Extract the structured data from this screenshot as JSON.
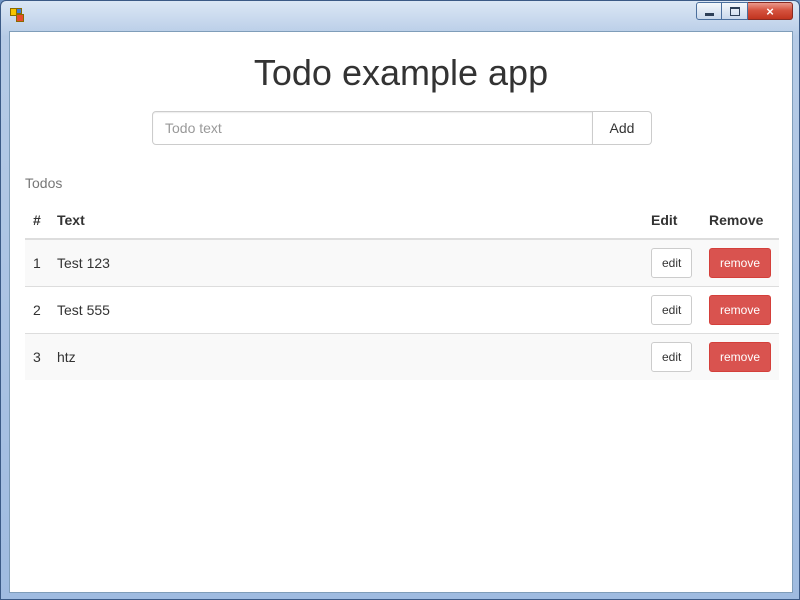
{
  "window": {
    "icon": "app-window-icon",
    "controls": {
      "minimize": "minimize-icon",
      "maximize": "maximize-icon",
      "close": "×"
    }
  },
  "app": {
    "title": "Todo example app",
    "input": {
      "value": "",
      "placeholder": "Todo text"
    },
    "add_label": "Add",
    "section_label": "Todos"
  },
  "table": {
    "headers": {
      "num": "#",
      "text": "Text",
      "edit": "Edit",
      "remove": "Remove"
    },
    "rows": [
      {
        "num": "1",
        "text": "Test 123",
        "edit": "edit",
        "remove": "remove"
      },
      {
        "num": "2",
        "text": "Test 555",
        "edit": "edit",
        "remove": "remove"
      },
      {
        "num": "3",
        "text": "htz",
        "edit": "edit",
        "remove": "remove"
      }
    ]
  },
  "colors": {
    "danger": "#d9534f",
    "title_text": "#333333",
    "window_frame": "#9fbbe0"
  }
}
